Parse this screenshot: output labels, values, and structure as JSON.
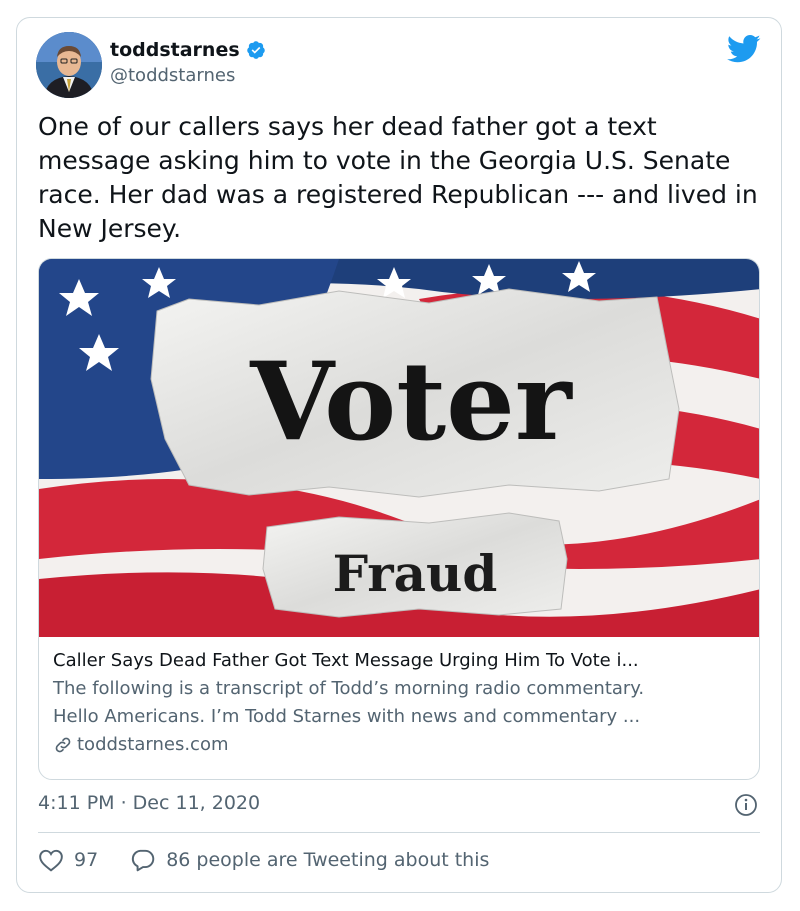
{
  "author": {
    "name": "toddstarnes",
    "handle": "@toddstarnes",
    "verified": true
  },
  "tweet": {
    "text": "One of our callers says her dead father got a text message asking him to vote in the Georgia U.S. Senate race. Her dad was a registered Republican --- and lived in New Jersey."
  },
  "link_card": {
    "image_word_1": "Voter",
    "image_word_2": "Fraud",
    "title": "Caller Says Dead Father Got Text Message Urging Him To Vote i...",
    "description_line1": "The following is a transcript of Todd’s morning radio commentary.",
    "description_line2": "Hello Americans. I’m Todd Starnes with news and commentary ...",
    "domain": "toddstarnes.com"
  },
  "meta": {
    "timestamp": "4:11 PM · Dec 11, 2020"
  },
  "actions": {
    "likes": "97",
    "conversation": "86 people are Tweeting about this"
  },
  "colors": {
    "twitter_blue": "#1d9bf0",
    "secondary_text": "#536471",
    "border": "#cfd9de"
  },
  "icons": [
    "verified-badge-icon",
    "twitter-bird-icon",
    "link-icon",
    "info-icon",
    "heart-icon",
    "reply-bubble-icon"
  ]
}
